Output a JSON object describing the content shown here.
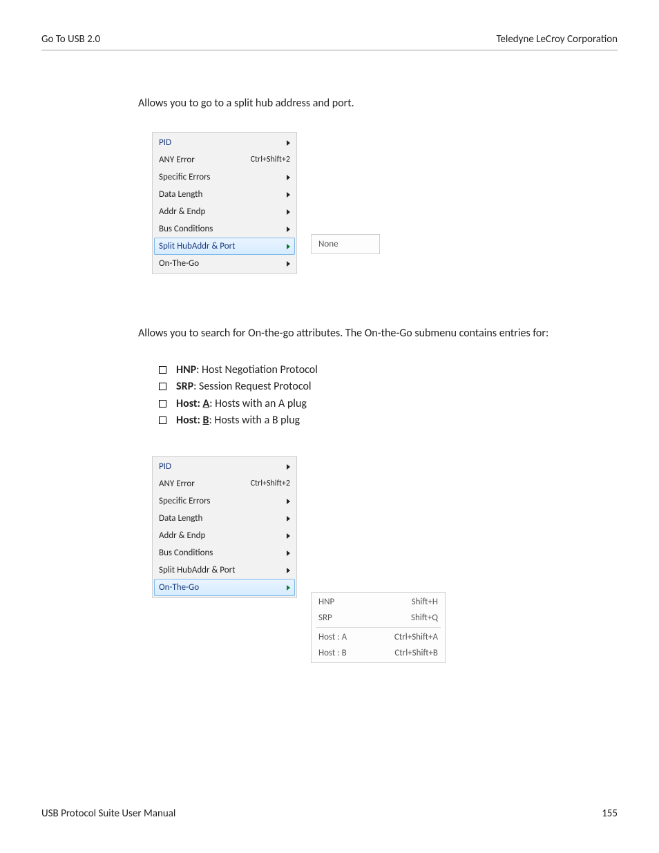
{
  "header": {
    "left": "Go To USB 2.0",
    "right": "Teledyne LeCroy Corporation"
  },
  "intro1": "Allows you to go to a split hub address and port.",
  "menu1": {
    "items": [
      {
        "label": "PID",
        "arrow": true,
        "highlighted": true
      },
      {
        "label": "ANY Error",
        "shortcut": "Ctrl+Shift+2"
      },
      {
        "label": "Specific Errors",
        "arrow": true
      },
      {
        "label": "Data Length",
        "arrow": true
      },
      {
        "label": "Addr & Endp",
        "arrow": true
      },
      {
        "label": "Bus Conditions",
        "arrow": true
      },
      {
        "label": "Split HubAddr & Port",
        "arrow": true,
        "selected": true,
        "green": true
      },
      {
        "label": "On-The-Go",
        "arrow": true
      }
    ],
    "submenu": [
      {
        "label": "None"
      }
    ]
  },
  "intro2": "Allows you to search for On-the-go attributes. The On-the-Go submenu contains entries for:",
  "bullets": [
    {
      "bold": "HNP",
      "text": ": Host Negotiation Protocol"
    },
    {
      "bold": "SRP",
      "text": ": Session Request Protocol"
    },
    {
      "bold": "Host: ",
      "ul": "A",
      "text": ": Hosts with an A plug"
    },
    {
      "bold": "Host: ",
      "ul": "B",
      "text": ": Hosts with a B plug"
    }
  ],
  "menu2": {
    "items": [
      {
        "label": "PID",
        "arrow": true,
        "highlighted": true
      },
      {
        "label": "ANY Error",
        "shortcut": "Ctrl+Shift+2"
      },
      {
        "label": "Specific Errors",
        "arrow": true
      },
      {
        "label": "Data Length",
        "arrow": true
      },
      {
        "label": "Addr & Endp",
        "arrow": true
      },
      {
        "label": "Bus Conditions",
        "arrow": true
      },
      {
        "label": "Split HubAddr & Port",
        "arrow": true
      },
      {
        "label": "On-The-Go",
        "arrow": true,
        "selected": true,
        "green": true
      }
    ],
    "submenu": [
      {
        "label": "HNP",
        "shortcut": "Shift+H"
      },
      {
        "label": "SRP",
        "shortcut": "Shift+Q"
      },
      {
        "divider": true
      },
      {
        "label": "Host : A",
        "shortcut": "Ctrl+Shift+A"
      },
      {
        "label": "Host : B",
        "shortcut": "Ctrl+Shift+B"
      }
    ]
  },
  "footer": {
    "left": "USB Protocol Suite User Manual",
    "right": "155"
  }
}
